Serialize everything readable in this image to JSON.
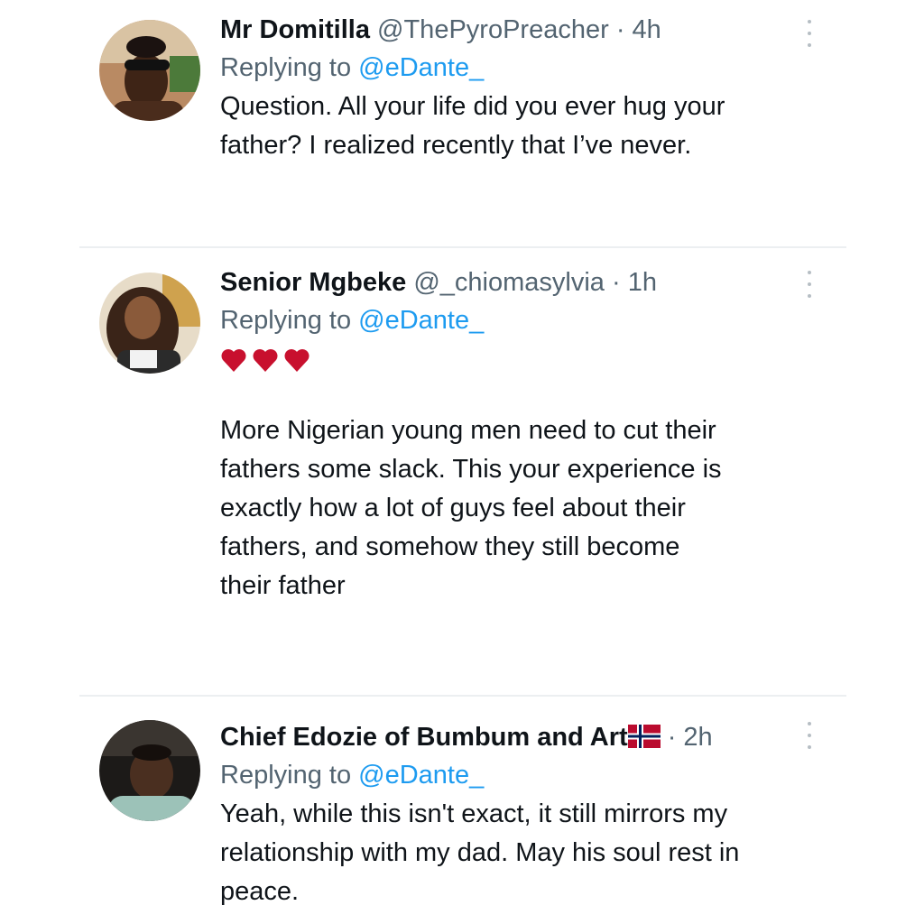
{
  "tweets": [
    {
      "name": "Mr Domitilla",
      "handle": "@ThePyroPreacher",
      "time": "· 4h",
      "replying_prefix": "Replying to ",
      "replying_to": "@eDante_",
      "text": "Question. All your life did you ever hug your\nfather? I realized recently that I’ve never.",
      "more_icon": "more-vertical-icon"
    },
    {
      "name": "Senior Mgbeke",
      "handle": "@_chiomasylvia",
      "time": "· 1h",
      "replying_prefix": "Replying to ",
      "replying_to": "@eDante_",
      "emoji": "♥♥♥",
      "text": "More Nigerian young men need to cut their\nfathers some slack. This your experience is\nexactly how a lot of guys feel about their\nfathers, and somehow they still become\ntheir father",
      "more_icon": "more-vertical-icon"
    },
    {
      "name": "Chief Edozie of Bumbum and Art",
      "flag": "Norway flag",
      "time": "· 2h",
      "replying_prefix": "Replying to ",
      "replying_to": "@eDante_",
      "text": "Yeah, while this isn't exact, it still mirrors my\nrelationship with my dad. May his soul rest in\npeace.",
      "more_icon": "more-vertical-icon"
    }
  ],
  "colors": {
    "mention": "#1d9bf0",
    "secondary_text": "#536471",
    "heart": "#c8102e",
    "divider": "#eceff1"
  }
}
